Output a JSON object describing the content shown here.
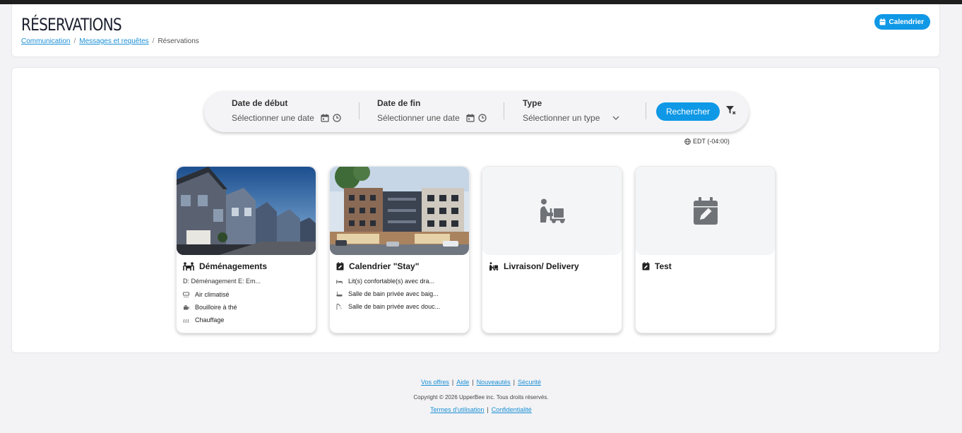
{
  "header": {
    "title": "RÉSERVATIONS",
    "breadcrumb": [
      "Communication",
      "Messages et requêtes",
      "Réservations"
    ],
    "calendar_button": "Calendrier"
  },
  "search": {
    "start": {
      "label": "Date de début",
      "placeholder": "Sélectionner une date"
    },
    "end": {
      "label": "Date de fin",
      "placeholder": "Sélectionner une date"
    },
    "type": {
      "label": "Type",
      "placeholder": "Sélectionner un type"
    },
    "button": "Rechercher",
    "timezone": "EDT (-04:00)"
  },
  "cards": [
    {
      "title": "Déménagements",
      "icon": "people-carry-icon",
      "subtitle": "D: Déménagement E: Em...",
      "amenities": [
        {
          "icon": "air-conditioner-icon",
          "label": "Air climatisé"
        },
        {
          "icon": "kettle-icon",
          "label": "Bouilloire à thé"
        },
        {
          "icon": "heating-icon",
          "label": "Chauffage"
        }
      ]
    },
    {
      "title": "Calendrier \"Stay\"",
      "icon": "calendar-edit-icon",
      "amenities": [
        {
          "icon": "bed-icon",
          "label": "Lit(s) confortable(s) avec dra..."
        },
        {
          "icon": "bathtub-icon",
          "label": "Salle de bain privée avec baig..."
        },
        {
          "icon": "shower-icon",
          "label": "Salle de bain privée avec douc..."
        }
      ]
    },
    {
      "title": "Livraison/ Delivery",
      "icon": "dolly-icon"
    },
    {
      "title": "Test",
      "icon": "calendar-edit-icon"
    }
  ],
  "footer": {
    "links": [
      "Vos offres",
      "Aide",
      "Nouveautés",
      "Sécurité"
    ],
    "copyright": "Copyright © 2026 UpperBee inc. Tous droits réservés.",
    "legal": [
      "Termes d'utilisation",
      "Confidentialité"
    ]
  },
  "colors": {
    "accent": "#0f98e6",
    "link": "#1a8fd6",
    "title": "#1c2130"
  }
}
